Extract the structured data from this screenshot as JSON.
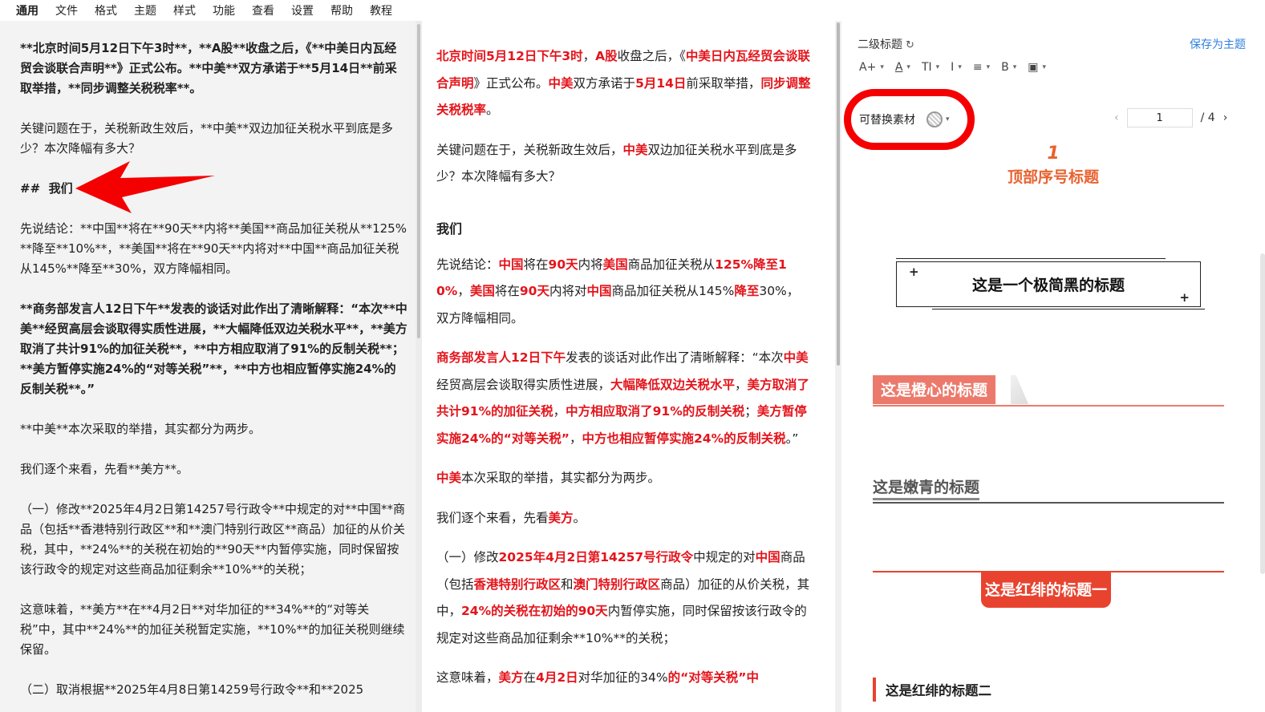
{
  "menu": [
    "通用",
    "文件",
    "格式",
    "主题",
    "样式",
    "功能",
    "查看",
    "设置",
    "帮助",
    "教程"
  ],
  "left_editor": {
    "p1": "**北京时间5月12日下午3时**，**A股**收盘之后，《**中美日内瓦经贸会谈联合声明**》正式公布。**中美**双方承诺于**5月14日**前采取举措，**同步调整关税税率**。",
    "p2": "关键问题在于，关税新政生效后，**中美**双边加征关税水平到底是多少？本次降幅有多大？",
    "h_mark": "##",
    "h_text": "我们",
    "p3": "先说结论：**中国**将在**90天**内将**美国**商品加征关税从**125%**降至**10%**，**美国**将在**90天**内将对**中国**商品加征关税从145%**降至**30%，双方降幅相同。",
    "p4": "**商务部发言人12日下午**发表的谈话对此作出了清晰解释：“本次**中美**经贸高层会谈取得实质性进展，**大幅降低双边关税水平**，**美方取消了共计91%的加征关税**，**中方相应取消了91%的反制关税**；**美方暂停实施24%的“对等关税”**，**中方也相应暂停实施24%的反制关税**。”",
    "p5": "**中美**本次采取的举措，其实都分为两步。",
    "p6": "我们逐个来看，先看**美方**。",
    "p7": "（一）修改**2025年4月2日第14257号行政令**中规定的对**中国**商品（包括**香港特别行政区**和**澳门特别行政区**商品）加征的从价关税，其中，**24%**的关税在初始的**90天**内暂停实施，同时保留按该行政令的规定对这些商品加征剩余**10%**的关税；",
    "p8": "这意味着，**美方**在**4月2日**对华加征的**34%**的“对等关税”中，其中**24%**的加征关税暂定实施，**10%**的加征关税则继续保留。",
    "p9": "（二）取消根据**2025年4月8日第14259号行政令**和**2025"
  },
  "preview": {
    "p1": [
      [
        "r",
        "北京时间5月12日下午3时"
      ],
      [
        "n",
        "，"
      ],
      [
        "r",
        "A股"
      ],
      [
        "n",
        "收盘之后，《"
      ],
      [
        "r",
        "中美日内瓦经贸会谈联合声明"
      ],
      [
        "n",
        "》正式公布。"
      ],
      [
        "r",
        "中美"
      ],
      [
        "n",
        "双方承诺于"
      ],
      [
        "r",
        "5月14日"
      ],
      [
        "n",
        "前采取举措，"
      ],
      [
        "r",
        "同步调整关税税率"
      ],
      [
        "n",
        "。"
      ]
    ],
    "p2": [
      [
        "n",
        "关键问题在于，关税新政生效后，"
      ],
      [
        "r",
        "中美"
      ],
      [
        "n",
        "双边加征关税水平到底是多少？本次降幅有多大？"
      ]
    ],
    "h": "我们",
    "p3": [
      [
        "n",
        "先说结论："
      ],
      [
        "r",
        "中国"
      ],
      [
        "n",
        "将在"
      ],
      [
        "r",
        "90天"
      ],
      [
        "n",
        "内将"
      ],
      [
        "r",
        "美国"
      ],
      [
        "n",
        "商品加征关税从"
      ],
      [
        "r",
        "125%降至10%"
      ],
      [
        "n",
        "，"
      ],
      [
        "r",
        "美国"
      ],
      [
        "n",
        "将在"
      ],
      [
        "r",
        "90天"
      ],
      [
        "n",
        "内将对"
      ],
      [
        "r",
        "中国"
      ],
      [
        "n",
        "商品加征关税从145%"
      ],
      [
        "r",
        "降至"
      ],
      [
        "n",
        "30%，双方降幅相同。"
      ]
    ],
    "p4": [
      [
        "r",
        "商务部发言人12日下午"
      ],
      [
        "n",
        "发表的谈话对此作出了清晰解释：“本次"
      ],
      [
        "r",
        "中美"
      ],
      [
        "n",
        "经贸高层会谈取得实质性进展，"
      ],
      [
        "r",
        "大幅降低双边关税水平"
      ],
      [
        "n",
        "，"
      ],
      [
        "r",
        "美方取消了共计91%的加征关税"
      ],
      [
        "n",
        "，"
      ],
      [
        "r",
        "中方相应取消了91%的反制关税"
      ],
      [
        "n",
        "；"
      ],
      [
        "r",
        "美方暂停实施24%的“对等关税”"
      ],
      [
        "n",
        "，"
      ],
      [
        "r",
        "中方也相应暂停实施24%的反制关税"
      ],
      [
        "n",
        "。”"
      ]
    ],
    "p5": [
      [
        "r",
        "中美"
      ],
      [
        "n",
        "本次采取的举措，其实都分为两步。"
      ]
    ],
    "p6": [
      [
        "n",
        "我们逐个来看，先看"
      ],
      [
        "r",
        "美方"
      ],
      [
        "n",
        "。"
      ]
    ],
    "p7": [
      [
        "n",
        "（一）修改"
      ],
      [
        "r",
        "2025年4月2日第14257号行政令"
      ],
      [
        "n",
        "中规定的对"
      ],
      [
        "r",
        "中国"
      ],
      [
        "n",
        "商品（包括"
      ],
      [
        "r",
        "香港特别行政区"
      ],
      [
        "n",
        "和"
      ],
      [
        "r",
        "澳门特别行政区"
      ],
      [
        "n",
        "商品）加征的从价关税，其中，"
      ],
      [
        "r",
        "24%的关税在初始的90天"
      ],
      [
        "n",
        "内暂停实施，同时保留按该行政令的规定对这些商品加征剩余**10%**的关税；"
      ]
    ],
    "p8": [
      [
        "n",
        "这意味着，"
      ],
      [
        "r",
        "美方"
      ],
      [
        "n",
        "在"
      ],
      [
        "r",
        "4月2日"
      ],
      [
        "n",
        "对华加征的34%"
      ],
      [
        "r",
        "的“对等关税”中"
      ]
    ]
  },
  "theme_panel": {
    "heading_level": "二级标题",
    "save_label": "保存为主题",
    "toolbar": [
      "A+",
      "A",
      "TI",
      "I",
      "≡",
      "B",
      "▣"
    ],
    "material_label": "可替换素材",
    "page_current": "1",
    "page_total": "/ 4",
    "styles": {
      "t1_num": "1",
      "t1_text": "顶部序号标题",
      "t2_text": "这是一个极简黑的标题",
      "t3_text": "这是橙心的标题",
      "t4_text": "这是嫩青的标题",
      "t5_text": "这是红绯的标题一",
      "t6_text": "这是红绯的标题二"
    }
  },
  "colors": {
    "accent_red": "#e4141b",
    "link_blue": "#2f7fdf",
    "orange": "#e8622f",
    "salmon": "#ec7a6c",
    "annotation": "#f40000"
  }
}
